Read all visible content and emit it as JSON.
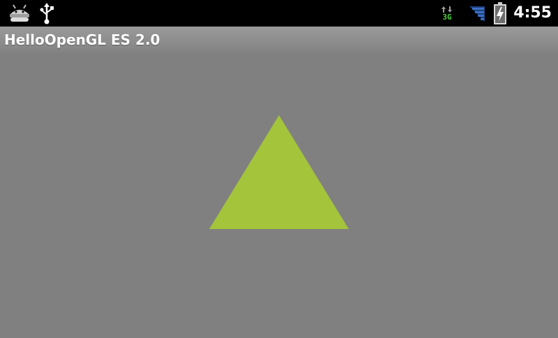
{
  "status_bar": {
    "time": "4:55",
    "network_type": "3G",
    "icons": {
      "notification_left": "android-debug-icon",
      "usb": "usb-icon",
      "network": "3g-data-icon",
      "signal": "signal-strength-icon",
      "battery": "battery-charging-icon"
    }
  },
  "title_bar": {
    "title": "HelloOpenGL ES 2.0"
  },
  "gl_view": {
    "background_color": "#808080",
    "shape": "triangle",
    "fill_color": "#a4c43b"
  }
}
